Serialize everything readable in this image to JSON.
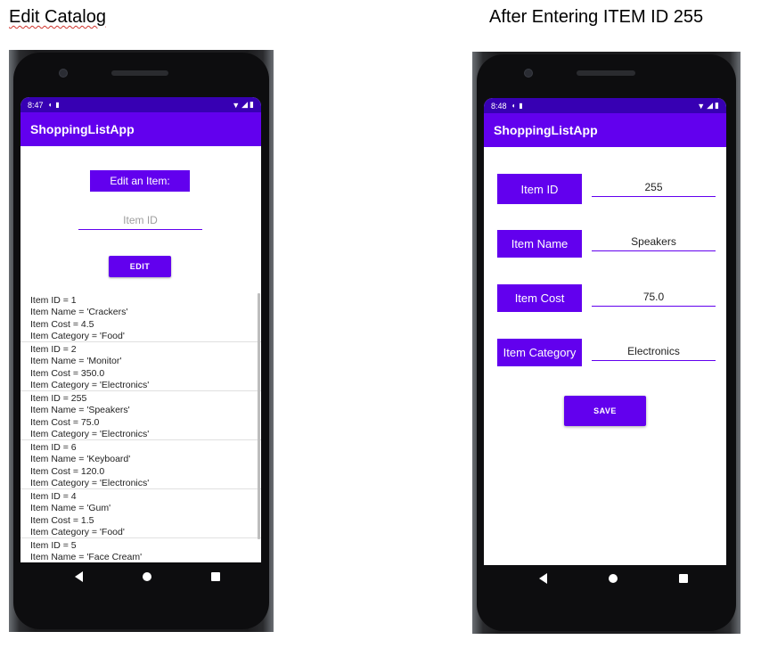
{
  "captions": {
    "left": "Edit Catalog",
    "right": "After Entering ITEM ID 255"
  },
  "left_phone": {
    "status": {
      "time": "8:47",
      "icons": [
        "motion-icon",
        "sd-card-icon"
      ],
      "right_icons": [
        "wifi-icon",
        "signal-icon",
        "battery-icon"
      ]
    },
    "app_title": "ShoppingListApp",
    "edit_title": "Edit an Item:",
    "item_id_placeholder": "Item ID",
    "edit_button": "EDIT",
    "items": [
      {
        "id": "Item ID = 1",
        "name": "Item Name = 'Crackers'",
        "cost": "Item Cost = 4.5",
        "category": "Item Category = 'Food'"
      },
      {
        "id": "Item ID = 2",
        "name": "Item Name = 'Monitor'",
        "cost": "Item Cost = 350.0",
        "category": "Item Category = 'Electronics'"
      },
      {
        "id": "Item ID = 255",
        "name": "Item Name = 'Speakers'",
        "cost": "Item Cost = 75.0",
        "category": "Item Category = 'Electronics'"
      },
      {
        "id": "Item ID = 6",
        "name": "Item Name = 'Keyboard'",
        "cost": "Item Cost = 120.0",
        "category": "Item Category = 'Electronics'"
      },
      {
        "id": "Item ID = 4",
        "name": "Item Name = 'Gum'",
        "cost": "Item Cost = 1.5",
        "category": "Item Category = 'Food'"
      },
      {
        "id": "Item ID = 5",
        "name": "Item Name = 'Face Cream'",
        "cost": "",
        "category": ""
      }
    ]
  },
  "right_phone": {
    "status": {
      "time": "8:48",
      "icons": [
        "motion-icon",
        "sd-card-icon"
      ],
      "right_icons": [
        "wifi-icon",
        "signal-icon",
        "battery-icon"
      ]
    },
    "app_title": "ShoppingListApp",
    "fields": [
      {
        "label": "Item ID",
        "value": "255"
      },
      {
        "label": "Item Name",
        "value": "Speakers"
      },
      {
        "label": "Item Cost",
        "value": "75.0"
      },
      {
        "label": "Item Category",
        "value": "Electronics"
      }
    ],
    "save_button": "SAVE"
  },
  "colors": {
    "primary": "#6200ee",
    "status_bar": "#3700b3"
  }
}
